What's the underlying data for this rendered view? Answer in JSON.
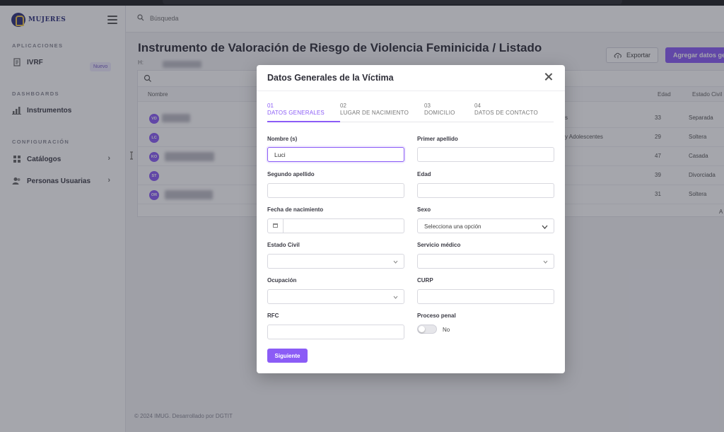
{
  "app": {
    "logo_text": "MUJERES"
  },
  "sidebar": {
    "sections": [
      {
        "title": "APLICACIONES",
        "items": [
          {
            "label": "IVRF",
            "icon": "document-icon",
            "badge": "Nuevo"
          }
        ]
      },
      {
        "title": "DASHBOARDS",
        "items": [
          {
            "label": "Instrumentos",
            "icon": "bar-chart-icon"
          }
        ]
      },
      {
        "title": "CONFIGURACIÓN",
        "items": [
          {
            "label": "Catálogos",
            "icon": "grid-icon",
            "chevron": "›"
          },
          {
            "label": "Personas Usuarias",
            "icon": "users-icon",
            "chevron": "›"
          }
        ]
      }
    ]
  },
  "header": {
    "search_placeholder": "Búsqueda"
  },
  "page": {
    "title": "Instrumento de Valoración de Riesgo de Violencia Feminicida / Listado",
    "subtitle": "H:",
    "export_label": "Exportar",
    "add_label": "Agregar datos gen"
  },
  "table": {
    "columns": {
      "name": "Nombre",
      "age": "Edad",
      "civil": "Estado Civil"
    },
    "rows": [
      {
        "initials": "VD",
        "extra": "s",
        "age": "33",
        "civil": "Separada"
      },
      {
        "initials": "LC",
        "extra": "y Adolescentes",
        "age": "29",
        "civil": "Soltera"
      },
      {
        "initials": "KO",
        "extra": "",
        "age": "47",
        "civil": "Casada"
      },
      {
        "initials": "ST",
        "extra": "",
        "age": "39",
        "civil": "Divorciada"
      },
      {
        "initials": "OR",
        "extra": "",
        "age": "31",
        "civil": "Soltera"
      }
    ],
    "pager_fragment": "A"
  },
  "footer": {
    "text": "© 2024 IMUG. Desarrollado por DGTIT"
  },
  "modal": {
    "title": "Datos Generales de la Víctima",
    "steps": [
      {
        "num": "01",
        "label": "DATOS GENERALES",
        "active": true
      },
      {
        "num": "02",
        "label": "LUGAR DE NACIMIENTO",
        "active": false
      },
      {
        "num": "03",
        "label": "DOMICILIO",
        "active": false
      },
      {
        "num": "04",
        "label": "DATOS DE CONTACTO",
        "active": false
      }
    ],
    "fields": {
      "nombre": {
        "label": "Nombre (s)",
        "value": "Luci"
      },
      "primer_apellido": {
        "label": "Primer apellido",
        "value": ""
      },
      "segundo_apellido": {
        "label": "Segundo apellido",
        "value": ""
      },
      "edad": {
        "label": "Edad",
        "value": ""
      },
      "fecha_nacimiento": {
        "label": "Fecha de nacimiento",
        "value": ""
      },
      "sexo": {
        "label": "Sexo",
        "selected": "Selecciona una opción"
      },
      "estado_civil": {
        "label": "Estado Civil",
        "selected": ""
      },
      "servicio_medico": {
        "label": "Servicio médico",
        "selected": ""
      },
      "ocupacion": {
        "label": "Ocupación",
        "selected": ""
      },
      "curp": {
        "label": "CURP",
        "value": ""
      },
      "rfc": {
        "label": "RFC",
        "value": ""
      },
      "proceso_penal": {
        "label": "Proceso penal",
        "toggle_text": "No",
        "on": false
      }
    },
    "next_label": "Siguiente"
  },
  "colors": {
    "accent": "#8b5cf6",
    "overlay": "#282a3a"
  }
}
